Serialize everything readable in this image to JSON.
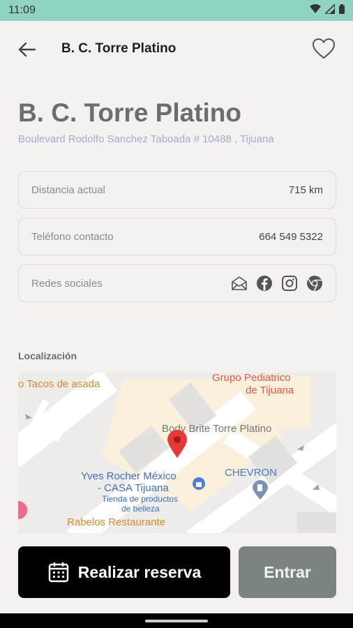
{
  "status_bar": {
    "time": "11:09"
  },
  "app_bar": {
    "title": "B. C. Torre Platino"
  },
  "header": {
    "title": "B. C. Torre Platino",
    "address": "Boulevard Rodolfo Sanchez Taboada # 10488 , Tijuana"
  },
  "info": {
    "distance_label": "Distancia actual",
    "distance_value": "715 km",
    "phone_label": "Teléfono contacto",
    "phone_value": "664 549 5322",
    "social_label": "Redes sociales",
    "social_icons": [
      "mail-icon",
      "facebook-icon",
      "instagram-icon",
      "chrome-icon"
    ]
  },
  "location": {
    "title": "Localización",
    "map_labels": {
      "tacos": "o Tacos de asada",
      "grupo_1": "Grupo Pediatrico",
      "grupo_2": "de Tijuana",
      "body_brite": "Body Brite Torre Platino",
      "chevron": "CHEVRON",
      "yves_1": "Yves Rocher México",
      "yves_2": "- CASA Tijuana",
      "tienda_1": "Tienda de productos",
      "tienda_2": "de belleza",
      "rabelos": "Rabelos Restaurante"
    }
  },
  "actions": {
    "reserve_label": "Realizar reserva",
    "enter_label": "Entrar"
  },
  "colors": {
    "status_bar": "#8fd3c2",
    "background": "#f4f1f0",
    "reserve_button": "#000000",
    "enter_button": "#7b8480",
    "map_pin": "#e53935"
  }
}
